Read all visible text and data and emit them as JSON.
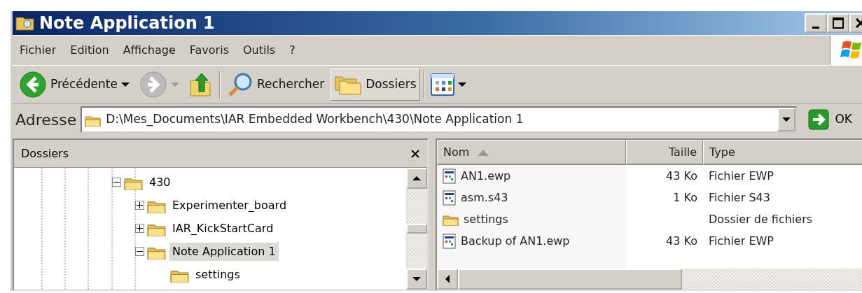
{
  "window": {
    "title": "Note Application 1"
  },
  "menu": [
    "Fichier",
    "Edition",
    "Affichage",
    "Favoris",
    "Outils",
    "?"
  ],
  "toolbar": [
    {
      "kind": "back",
      "label": "Précédente",
      "disabled": false
    },
    {
      "kind": "forward",
      "disabled": true
    },
    {
      "kind": "up"
    },
    {
      "kind": "search",
      "label": "Rechercher",
      "selected": false
    },
    {
      "kind": "folders",
      "label": "Dossiers",
      "selected": true
    },
    {
      "kind": "views"
    }
  ],
  "address": {
    "label": "Adresse",
    "value": "D:\\Mes_Documents\\IAR Embedded Workbench\\430\\Note Application 1",
    "go": "OK"
  },
  "folders_pane": {
    "title": "Dossiers",
    "tree": [
      {
        "label": "430",
        "has_children": true,
        "expanded": true,
        "selected": false,
        "children": [
          {
            "label": "Experimenter_board",
            "has_children": true,
            "expanded": false,
            "selected": false
          },
          {
            "label": "IAR_KickStartCard",
            "has_children": true,
            "expanded": false,
            "selected": false
          },
          {
            "label": "Note Application 1",
            "has_children": true,
            "expanded": true,
            "selected": true,
            "children": [
              {
                "label": "settings",
                "has_children": false,
                "selected": false
              }
            ]
          }
        ]
      }
    ]
  },
  "file_list": {
    "columns": [
      {
        "label": "Nom",
        "sorted": true
      },
      {
        "label": "Taille",
        "sorted": false
      },
      {
        "label": "Type",
        "sorted": false
      }
    ],
    "rows": [
      {
        "kind": "file",
        "name": "AN1.ewp",
        "size": "43 Ko",
        "type": "Fichier EWP"
      },
      {
        "kind": "file",
        "name": "asm.s43",
        "size": "1 Ko",
        "type": "Fichier S43"
      },
      {
        "kind": "folder",
        "name": "settings",
        "type": "Dossier de fichiers"
      },
      {
        "kind": "file",
        "name": "Backup of AN1.ewp",
        "size": "43 Ko",
        "type": "Fichier EWP"
      }
    ]
  }
}
